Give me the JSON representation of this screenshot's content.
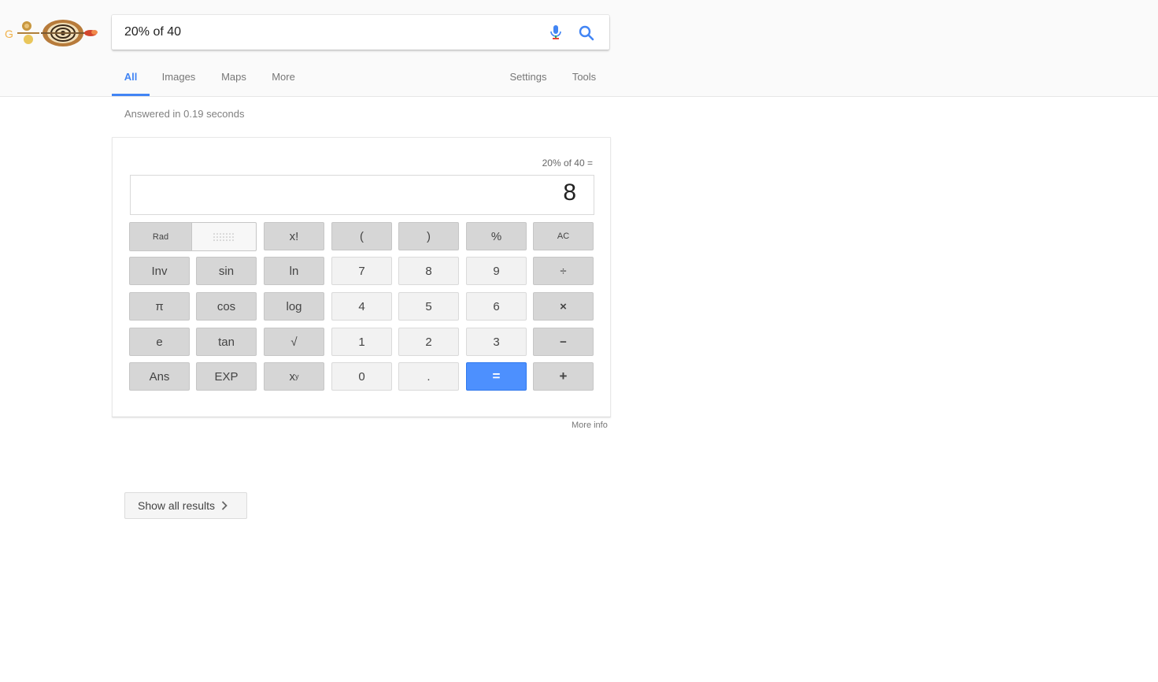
{
  "search": {
    "query": "20% of 40"
  },
  "tabs": [
    {
      "label": "All",
      "active": true
    },
    {
      "label": "Images"
    },
    {
      "label": "Maps"
    },
    {
      "label": "More"
    },
    {
      "label": "Settings"
    },
    {
      "label": "Tools"
    }
  ],
  "result_stats": "Answered in 0.19 seconds",
  "calculator": {
    "expression": "20% of 40 =",
    "result": "8",
    "mode_rad": "Rad",
    "buttons": {
      "fact": "x!",
      "lparen": "(",
      "rparen": ")",
      "percent": "%",
      "ac": "AC",
      "inv": "Inv",
      "sin": "sin",
      "ln": "ln",
      "n7": "7",
      "n8": "8",
      "n9": "9",
      "divide": "÷",
      "pi": "π",
      "cos": "cos",
      "log": "log",
      "n4": "4",
      "n5": "5",
      "n6": "6",
      "multiply": "×",
      "e": "e",
      "tan": "tan",
      "sqrt": "√",
      "n1": "1",
      "n2": "2",
      "n3": "3",
      "minus": "−",
      "ans": "Ans",
      "exp": "EXP",
      "pow_base": "x",
      "pow_exp": "y",
      "n0": "0",
      "dot": ".",
      "equals": "=",
      "plus": "+"
    }
  },
  "more_info": "More info",
  "show_all": "Show all results",
  "colors": {
    "accent": "#4285f4",
    "equals_button": "#4d90fe",
    "function_button": "#d6d6d6",
    "number_button": "#f2f2f2"
  }
}
